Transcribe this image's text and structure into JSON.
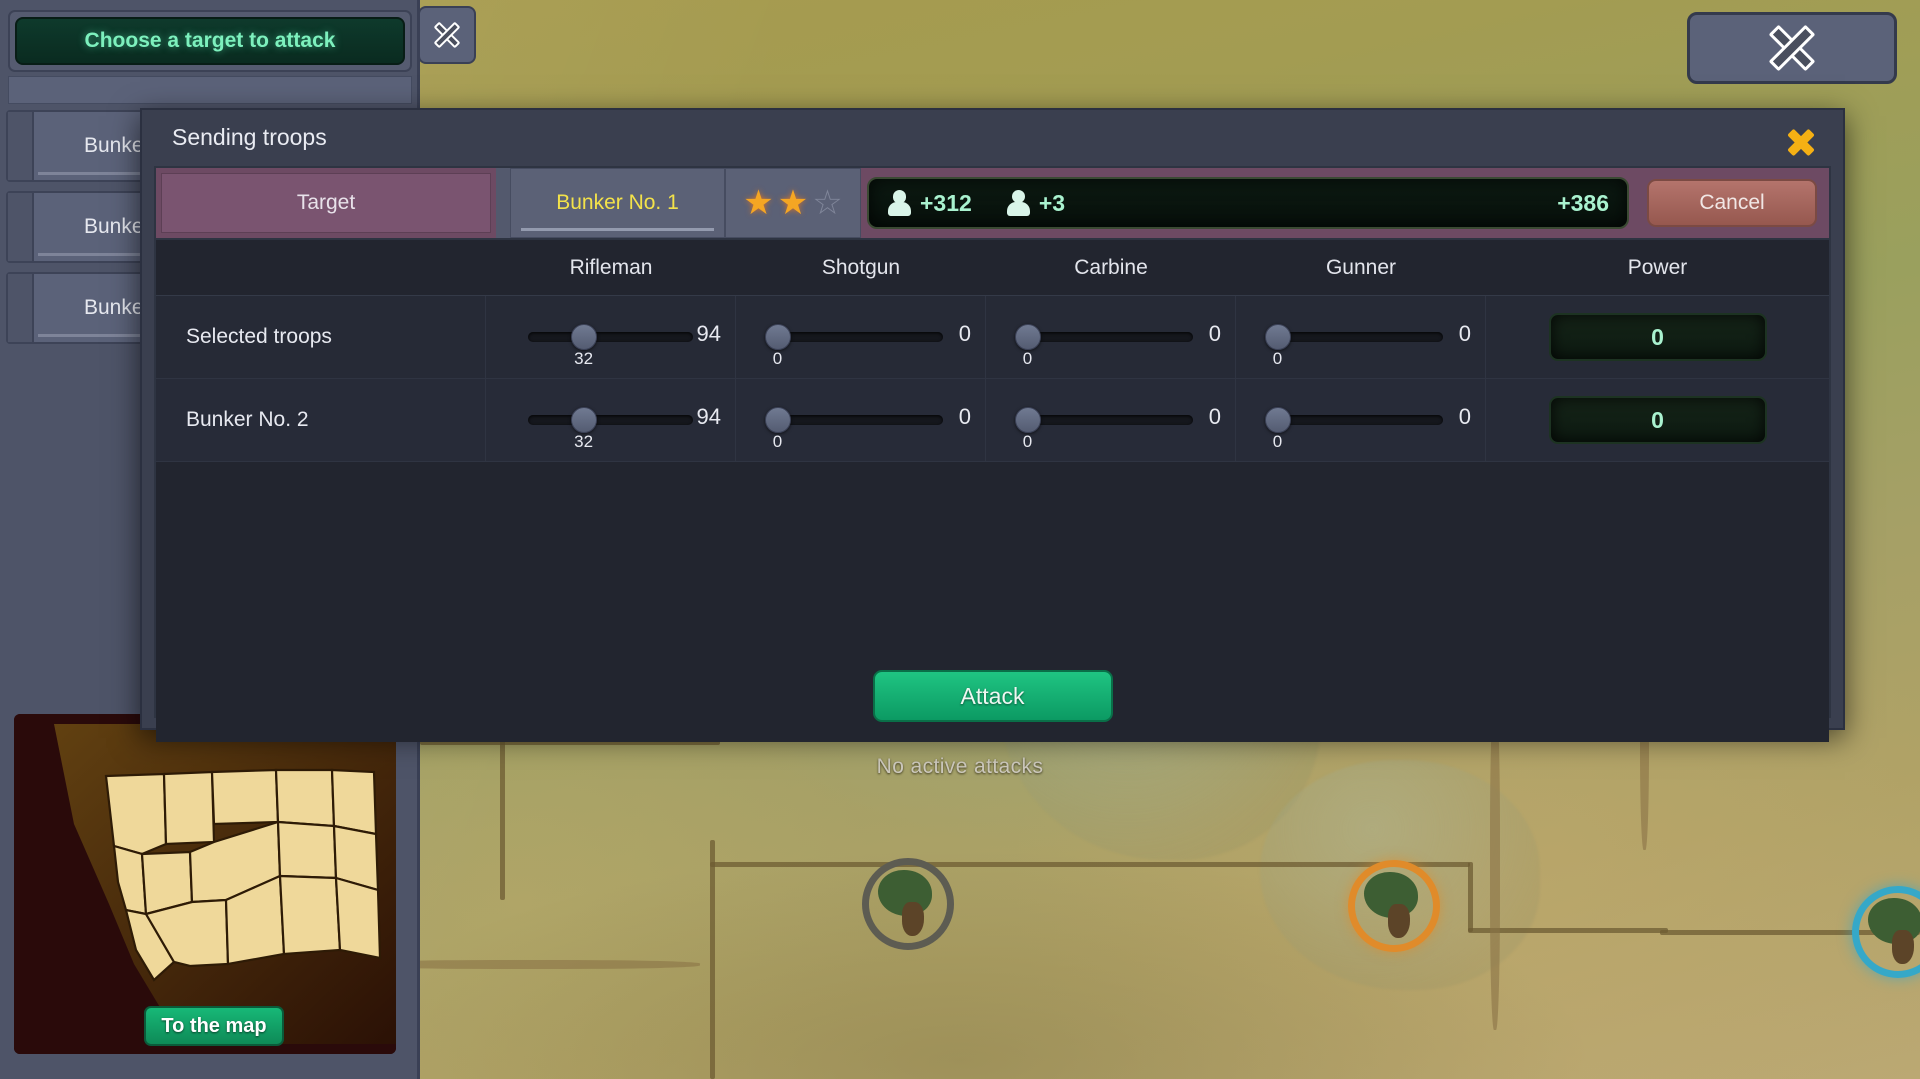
{
  "background": {
    "no_active_attacks": "No active attacks"
  },
  "left_panel": {
    "choose_target_label": "Choose a target to attack",
    "close_icon": "close-icon",
    "bunker_items": [
      {
        "label": "Bunker"
      },
      {
        "label": "Bunker "
      },
      {
        "label": "Bunker "
      }
    ],
    "to_the_map_label": "To the map"
  },
  "top_right": {
    "close_icon": "close-icon"
  },
  "modal": {
    "title": "Sending troops",
    "close_icon": "close-icon",
    "topbar": {
      "target_label": "Target",
      "bunker_label": "Bunker No. 1",
      "stars_filled": 2,
      "stars_total": 3,
      "stats": {
        "hooded_icon": "hooded-person-icon",
        "hooded_value": "+312",
        "person_icon": "person-icon",
        "person_value": "+3",
        "total_value": "+386"
      },
      "cancel_label": "Cancel"
    },
    "columns": [
      "Rifleman",
      "Shotgun",
      "Carbine",
      "Gunner",
      "Power"
    ],
    "rows": [
      {
        "name": "Selected troops",
        "troops": [
          {
            "current": "32",
            "max": "94",
            "percent": 34
          },
          {
            "current": "0",
            "max": "0",
            "percent": 0
          },
          {
            "current": "0",
            "max": "0",
            "percent": 0
          },
          {
            "current": "0",
            "max": "0",
            "percent": 0
          }
        ],
        "power": "0"
      },
      {
        "name": "Bunker No. 2",
        "troops": [
          {
            "current": "32",
            "max": "94",
            "percent": 34
          },
          {
            "current": "0",
            "max": "0",
            "percent": 0
          },
          {
            "current": "0",
            "max": "0",
            "percent": 0
          },
          {
            "current": "0",
            "max": "0",
            "percent": 0
          }
        ],
        "power": "0"
      }
    ],
    "attack_label": "Attack"
  },
  "colors": {
    "accent_green": "#1fc482",
    "accent_purple": "#6d4a63",
    "accent_yellow": "#f3e24a",
    "star_gold": "#f5a623",
    "cancel_red": "#b4746c",
    "stat_text": "#a9f2cf"
  }
}
